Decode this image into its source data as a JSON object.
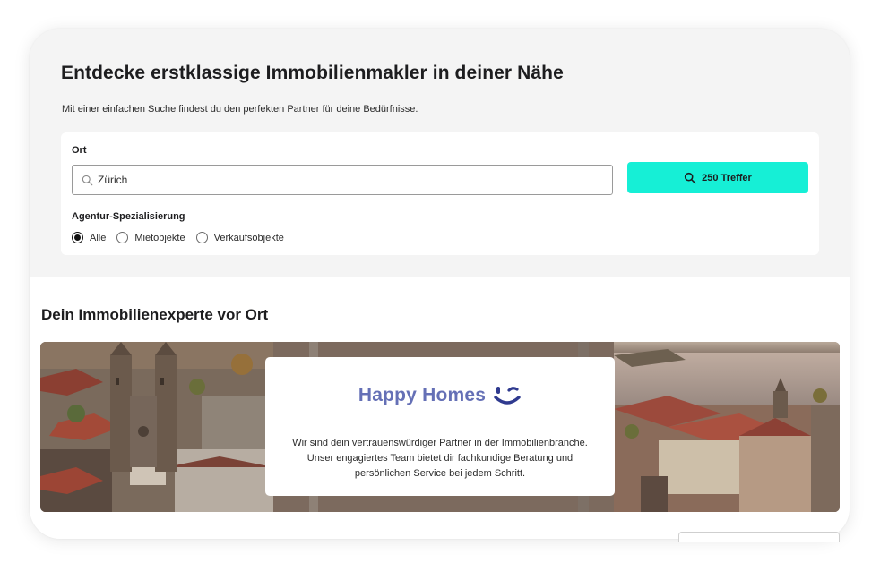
{
  "hero": {
    "title": "Entdecke erstklassige Immobilienmakler in deiner Nähe",
    "subtitle": "Mit einer einfachen Suche findest du den perfekten Partner für deine Bedürfnisse."
  },
  "search": {
    "location_label": "Ort",
    "location_value": "Zürich",
    "results_button_label": "250 Treffer",
    "specialization_label": "Agentur-Spezialisierung",
    "options": [
      {
        "label": "Alle",
        "checked": true
      },
      {
        "label": "Mietobjekte",
        "checked": false
      },
      {
        "label": "Verkaufsobjekte",
        "checked": false
      }
    ]
  },
  "expert": {
    "section_title": "Dein Immobilienexperte vor Ort",
    "brand_name": "Happy Homes",
    "brand_icon": "smiley-logo-icon",
    "description": "Wir sind dein vertrauenswürdiger Partner in der Immobilienbranche. Unser engagiertes Team bietet dir fachkundige Beratung und persönlichen Service bei jedem Schritt."
  },
  "colors": {
    "accent": "#16efd6",
    "brand": "#6570b6",
    "text": "#1d1d1f"
  }
}
